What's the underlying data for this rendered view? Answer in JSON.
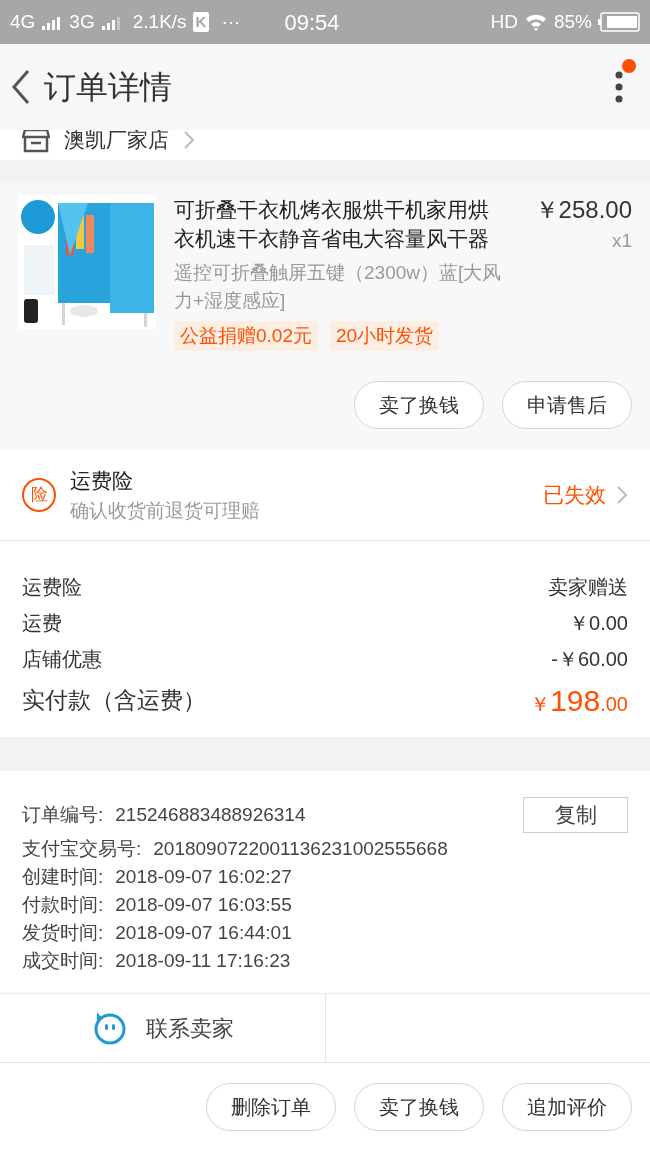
{
  "status_bar": {
    "network_1": "4G",
    "network_2": "3G",
    "speed": "2.1K/s",
    "app_badge": "K",
    "more": "···",
    "time": "09:54",
    "hd": "HD",
    "battery": "85%"
  },
  "header": {
    "title": "订单详情",
    "notification_dot": true
  },
  "store": {
    "name": "澳凯厂家店"
  },
  "product": {
    "image": {
      "kind": "picture"
    },
    "title": "可折叠干衣机烤衣服烘干机家用烘衣机速干衣静音省电大容量风干器",
    "variant": "遥控可折叠触屏五键（2300w）蓝[大风力+湿度感应]",
    "price": "￥258.00",
    "quantity": "x1",
    "tags": [
      "公益捐赠0.02元",
      "20小时发货"
    ],
    "actions": [
      "卖了换钱",
      "申请售后"
    ]
  },
  "insurance": {
    "icon_text": "险",
    "title": "运费险",
    "subtitle": "确认收货前退货可理赔",
    "status": "已失效"
  },
  "fees": [
    {
      "label": "运费险",
      "value": "卖家赠送"
    },
    {
      "label": "运费",
      "value": "￥0.00"
    },
    {
      "label": "店铺优惠",
      "value": "-￥60.00"
    }
  ],
  "total": {
    "label": "实付款（含运费）",
    "currency": "￥",
    "amount": "198",
    "cents": ".00"
  },
  "order_info": {
    "copy_button": "复制",
    "rows": [
      {
        "label": "订单编号:",
        "value": "215246883488926314"
      },
      {
        "label": "支付宝交易号:",
        "value": "2018090722001136231002555668"
      },
      {
        "label": "创建时间:",
        "value": "2018-09-07 16:02:27"
      },
      {
        "label": "付款时间:",
        "value": "2018-09-07 16:03:55"
      },
      {
        "label": "发货时间:",
        "value": "2018-09-07 16:44:01"
      },
      {
        "label": "成交时间:",
        "value": "2018-09-11 17:16:23"
      }
    ]
  },
  "contact": {
    "label": "联系卖家"
  },
  "bottom_actions": [
    "删除订单",
    "卖了换钱",
    "追加评价"
  ]
}
